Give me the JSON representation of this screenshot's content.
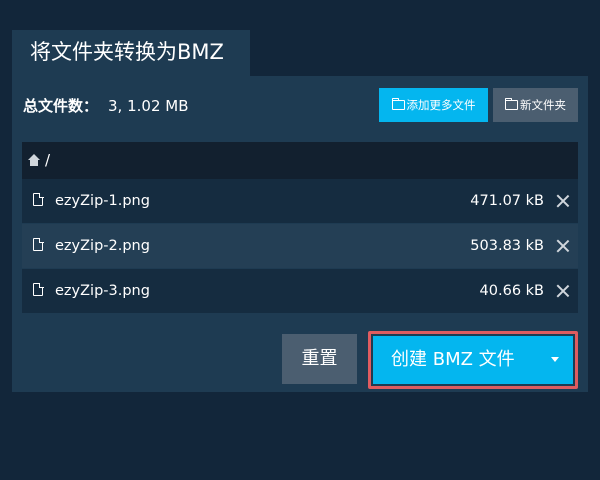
{
  "tab": {
    "title": "将文件夹转换为BMZ"
  },
  "summary": {
    "label": "总文件数：",
    "value": "3, 1.02 MB"
  },
  "toolbar": {
    "add_more_label": "添加更多文件",
    "new_folder_label": "新文件夹"
  },
  "path": {
    "current": "/"
  },
  "files": [
    {
      "name": "ezyZip-1.png",
      "size": "471.07 kB"
    },
    {
      "name": "ezyZip-2.png",
      "size": "503.83 kB"
    },
    {
      "name": "ezyZip-3.png",
      "size": "40.66 kB"
    }
  ],
  "actions": {
    "reset_label": "重置",
    "create_label": "创建 BMZ 文件"
  },
  "colors": {
    "background": "#12263a",
    "panel": "#1e3b52",
    "accent": "#04b6ef",
    "secondary_button": "#4b5e70",
    "highlight_border": "#df5c60"
  }
}
